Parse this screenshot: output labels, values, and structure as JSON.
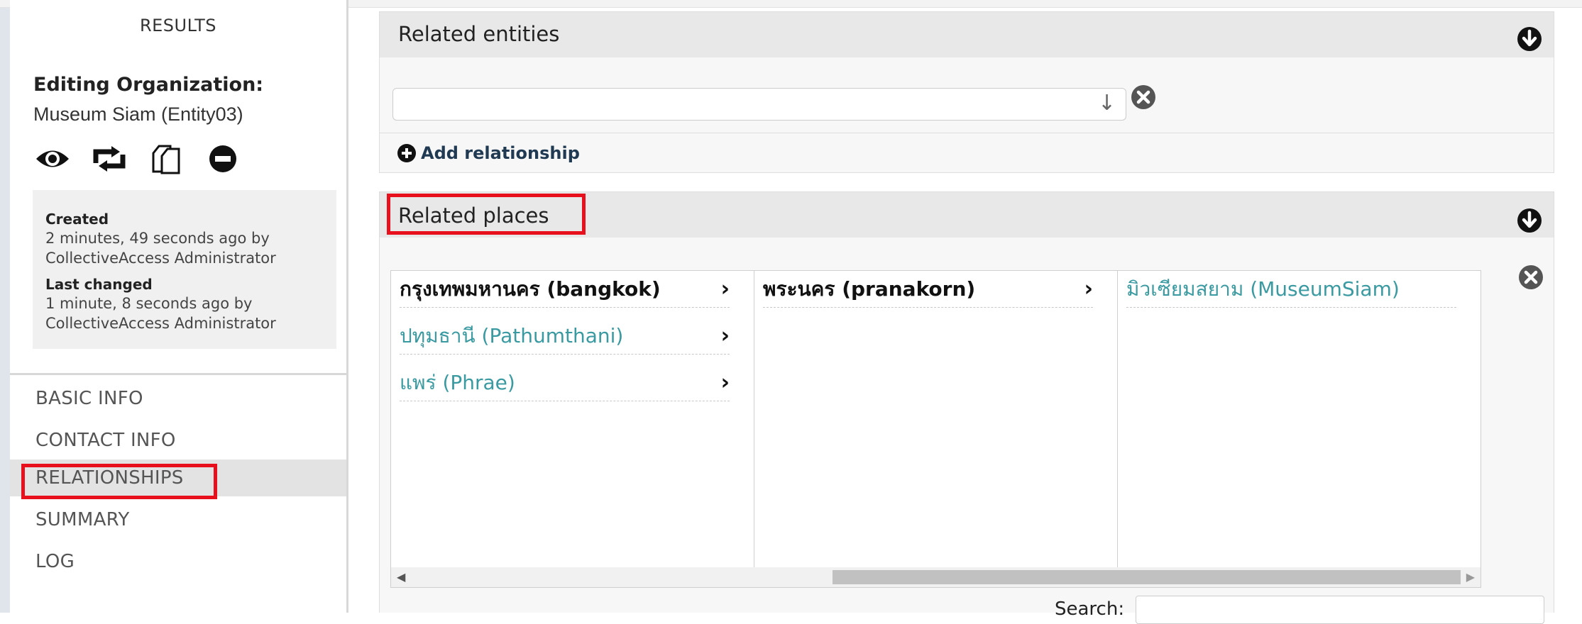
{
  "sidebar": {
    "results_label": "RESULTS",
    "editing_heading": "Editing Organization:",
    "editing_name": "Museum Siam (Entity03)",
    "action_icons": [
      "eye-icon",
      "duplicate-icon",
      "copy-icon",
      "delete-icon"
    ],
    "info": {
      "created_label": "Created",
      "created_text1": "2 minutes, 49 seconds ago by",
      "created_text2": "CollectiveAccess Administrator",
      "changed_label": "Last changed",
      "changed_text1": "1 minute, 8 seconds ago by",
      "changed_text2": "CollectiveAccess Administrator"
    },
    "nav": [
      {
        "label": "BASIC INFO",
        "active": false
      },
      {
        "label": "CONTACT INFO",
        "active": false
      },
      {
        "label": "RELATIONSHIPS",
        "active": true
      },
      {
        "label": "SUMMARY",
        "active": false
      },
      {
        "label": "LOG",
        "active": false
      }
    ]
  },
  "related_entities": {
    "title": "Related entities",
    "input_value": "",
    "add_label": "Add relationship"
  },
  "related_places": {
    "title": "Related places",
    "columns": [
      [
        {
          "label": "กรุงเทพมหานคร (bangkok)",
          "selected": true,
          "has_children": true
        },
        {
          "label": "ปทุมธานี (Pathumthani)",
          "selected": false,
          "has_children": true
        },
        {
          "label": "แพร่ (Phrae)",
          "selected": false,
          "has_children": true
        }
      ],
      [
        {
          "label": "พระนคร (pranakorn)",
          "selected": true,
          "has_children": true
        }
      ],
      [
        {
          "label": "มิวเซียมสยาม (MuseumSiam)",
          "selected": false,
          "has_children": false
        }
      ]
    ],
    "scroll_position": 0.4,
    "search_label": "Search:",
    "search_value": ""
  },
  "colors": {
    "highlight": "#e8101c",
    "link": "#3a9aa2",
    "panel_header": "#e8e8e8",
    "nav_active": "#e3e3e3"
  }
}
